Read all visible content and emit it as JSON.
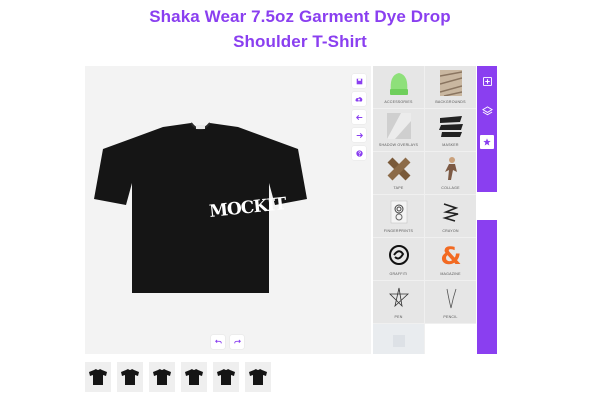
{
  "product": {
    "title_line1": "Shaka Wear 7.5oz Garment Dye Drop",
    "title_line2": "Shoulder T-Shirt"
  },
  "design": {
    "graphic_text": "MOCKIT"
  },
  "toolbar": {
    "icons": [
      "save-icon",
      "cloud-upload-icon",
      "arrow-left-icon",
      "arrow-right-icon",
      "help-icon"
    ]
  },
  "history": {
    "icons": [
      "undo-icon",
      "redo-icon"
    ]
  },
  "panel": {
    "categories": [
      "ACCESSORIES",
      "BACKGROUNDS",
      "SHADOW OVERLAYS",
      "MASKER",
      "TAPE",
      "COLLAGE",
      "FINGERPRINTS",
      "CRAYON",
      "GRAFFITI",
      "MAGAZINE",
      "PEN",
      "PENCIL"
    ]
  },
  "rail": {
    "icons": [
      "add-icon",
      "layers-icon",
      "star-icon"
    ]
  },
  "thumbnails": {
    "count": 6
  },
  "colors": {
    "accent": "#8a3ff0",
    "canvas_bg": "#f3f3f3",
    "shirt": "#151515"
  }
}
